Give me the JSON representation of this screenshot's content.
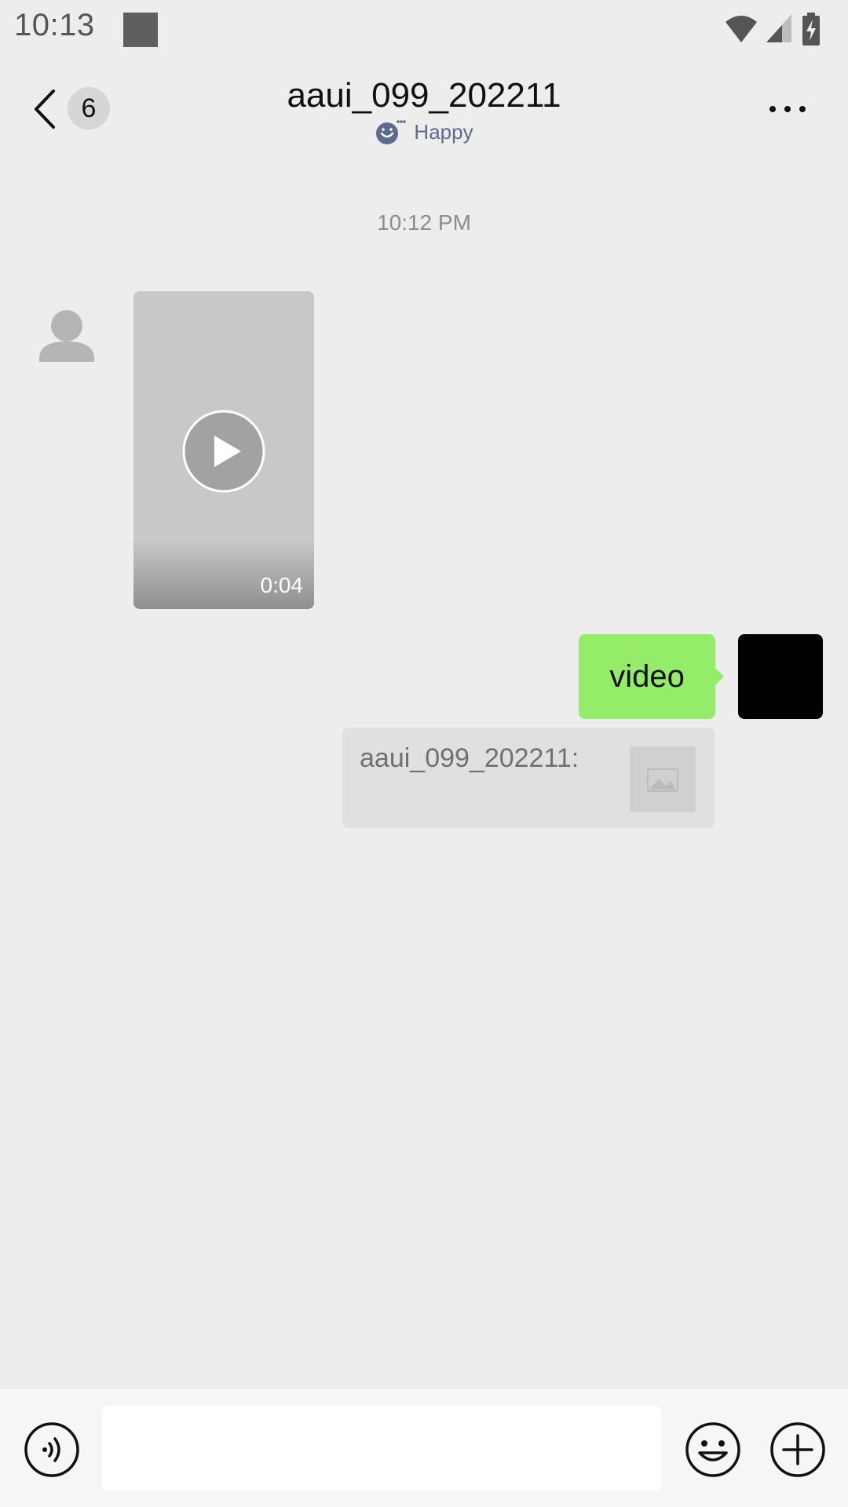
{
  "status_bar": {
    "time": "10:13",
    "icons": [
      "notification-square",
      "wifi-icon",
      "cell-signal-icon",
      "battery-charging-icon"
    ]
  },
  "header": {
    "back_badge": "6",
    "title": "aaui_099_202211",
    "status": "Happy",
    "icons": [
      "back-chevron-icon",
      "mood-icon",
      "more-icon"
    ]
  },
  "chat": {
    "timestamp": "10:12 PM",
    "messages": [
      {
        "side": "left",
        "type": "video",
        "duration": "0:04"
      },
      {
        "side": "right",
        "type": "text",
        "text": "video"
      },
      {
        "side": "right",
        "type": "quote",
        "quote_text": "aaui_099_202211:"
      }
    ]
  },
  "colors": {
    "background": "#ededed",
    "sent_bubble": "#95ec69",
    "status_text": "#5d6b8d"
  },
  "input_bar": {
    "value": "",
    "placeholder": "",
    "icons": [
      "voice-icon",
      "emoji-icon",
      "plus-icon"
    ]
  }
}
